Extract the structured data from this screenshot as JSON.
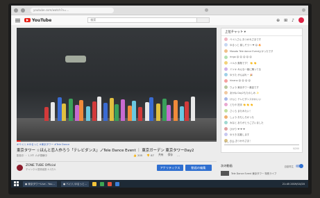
{
  "browser": {
    "url": "youtube.com/watch?v=..."
  },
  "header": {
    "logo_text": "YouTube",
    "search_placeholder": "検索",
    "icons": [
      "menu-icon",
      "search-icon",
      "upload-icon",
      "apps-icon",
      "notifications-icon",
      "avatar"
    ]
  },
  "video": {
    "tags": "#ベイ八 #ゆるっと #東京タワー #Tele Dance",
    "title": "東京タワー ☆ほんと恋人作ろう「テレビダンス」ノTele Dance Event ｜ 東京ガーデン 東京タワーDay2",
    "views": "配信中 ・ 1,5千 人が視聴中",
    "progress": 0.02,
    "actions": {
      "like": "205",
      "dislike": "87",
      "share": "共有",
      "save": "保存",
      "more": "…"
    }
  },
  "channel": {
    "name": "ZONE TUBE Official",
    "subscribers": "チャンネル登録者数 4.2万人",
    "analytics_button": "アナリティクス",
    "edit_button": "動画の編集"
  },
  "chat": {
    "header": "上位チャット ▾",
    "messages": [
      {
        "text": "ベイ八さん  おつかれさまです",
        "color": "#f0b6c2"
      },
      {
        "text": "ゆるっと  楽しそう〜 ❤ 😊 🔥",
        "color": "#c6d7f2"
      },
      {
        "text": "Masato  Tele dance Eventよかったです",
        "color": "#efc08a"
      },
      {
        "text": "ringo  😊 😊 😊 😊 😊",
        "color": "#b2e0b2"
      },
      {
        "text": "ハルカ  素敵です！ 👏 👏",
        "color": "#f2d27a"
      },
      {
        "text": "ミツキ  みんな一緒に踊ってる",
        "color": "#d1b0e8"
      },
      {
        "text": "ゆうた  がんばれー 🎉",
        "color": "#9fd0e8"
      },
      {
        "text": "hinano  😊 😊 😊 😊",
        "color": "#f5a0a0"
      },
      {
        "text": "りょう  東京タワー最高です",
        "color": "#b8c8a0"
      },
      {
        "text": "あかね  Day2もたのしみ ✨",
        "color": "#f0c8a0"
      },
      {
        "text": "けんじ  テレビダンスかわいい",
        "color": "#a8b8e8"
      },
      {
        "text": "ともや  拍手 👏 👏 👏",
        "color": "#e8a8d0"
      },
      {
        "text": "さくら  またみたい！",
        "color": "#c0e0a0"
      },
      {
        "text": "しょう  おもしろかった",
        "color": "#f0b070"
      },
      {
        "text": "みなと  ありがとうございました",
        "color": "#a0d8d0"
      },
      {
        "text": "ひかり  ❤ ❤ ❤",
        "color": "#e0a0a0"
      },
      {
        "text": "ゆうき  拡散します",
        "color": "#c8c8f0"
      },
      {
        "text": "れん  おつかれさま！",
        "color": "#d8c080"
      }
    ],
    "input_placeholder": "チャット…",
    "char_count": "0/200"
  },
  "playlist": {
    "label": "次の動画",
    "autoplay_label": "自動再生",
    "item_title": "Tele Dance Event 東京タワー 特別ライブ"
  },
  "taskbar": {
    "items": [
      "● 東京タワーLive - You…",
      "● ベイ八 ゆるっと…"
    ],
    "clock": "21:45  2019/10/20"
  }
}
